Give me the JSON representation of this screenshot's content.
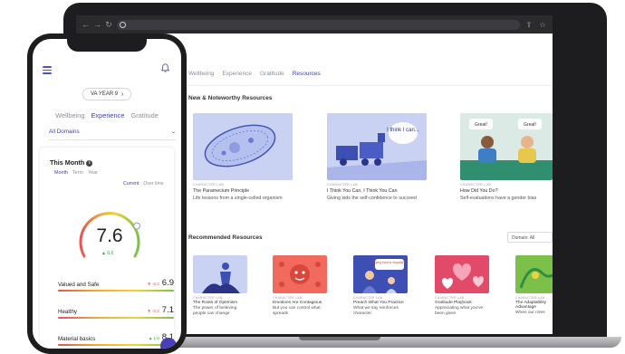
{
  "web": {
    "nav_tabs": [
      {
        "label": "Wellbeing",
        "active": false
      },
      {
        "label": "Experience",
        "active": false
      },
      {
        "label": "Gratitude",
        "active": false
      },
      {
        "label": "Resources",
        "active": true
      }
    ],
    "new_section_title": "New & Noteworthy Resources",
    "featured": [
      {
        "meta": "CHARACTER LAB",
        "title": "The Paramecium Principle",
        "desc": "Life lessons from a single-celled organism"
      },
      {
        "meta": "CHARACTER LAB",
        "title": "I Think You Can, I Think You Can",
        "desc": "Giving kids the self-confidence to succeed",
        "thumb_text": "I think I can..."
      },
      {
        "meta": "CHARACTER LAB",
        "title": "How Did You Do?",
        "desc": "Self-evaluations have a gender bias",
        "bubble_left": "Great!",
        "bubble_right": "Great!"
      }
    ],
    "recommended_title": "Recommended Resources",
    "domain_select": "Domain: All",
    "recommended": [
      {
        "meta": "CHARACTER LAB",
        "title": "The Roots of Optimism",
        "desc": "The power of believing people can change"
      },
      {
        "meta": "CHARACTER LAB",
        "title": "Emotions Are Contagious",
        "desc": "But you can control what spreads"
      },
      {
        "meta": "CHARACTER LAB",
        "title": "Preach What You Practice",
        "desc": "What we say reinforces character.",
        "thumb_text": "Trying hard is important!"
      },
      {
        "meta": "CHARACTER LAB",
        "title": "Gratitude Playbook",
        "desc": "Appreciating what you've been given"
      },
      {
        "meta": "CHARACTER LAB",
        "title": "The Adaptability Advantage",
        "desc": "When our roles"
      }
    ]
  },
  "phone": {
    "year_label": "VA YEAR 9",
    "tabs": [
      {
        "label": "Wellbeing",
        "active": false
      },
      {
        "label": "Experience",
        "active": true
      },
      {
        "label": "Gratitude",
        "active": false
      }
    ],
    "domains_label": "All Domains",
    "this_month": "This Month",
    "periods": [
      {
        "label": "Month",
        "active": true
      },
      {
        "label": "Term",
        "active": false
      },
      {
        "label": "Year",
        "active": false
      }
    ],
    "views": [
      {
        "label": "Current",
        "active": true
      },
      {
        "label": "Over time",
        "active": false
      }
    ],
    "gauge": {
      "value": "7.6",
      "delta": "▲ 0.6",
      "fraction": 0.76
    },
    "metrics": [
      {
        "label": "Valued and Safe",
        "delta": "▼ -0.2",
        "direction": "down",
        "value": "6.9"
      },
      {
        "label": "Healthy",
        "delta": "▼ -0.3",
        "direction": "down",
        "value": "7.1"
      },
      {
        "label": "Material basics",
        "delta": "▲ 1.6",
        "direction": "up",
        "value": "8.1"
      }
    ]
  },
  "colors": {
    "accent": "#3b3fb3",
    "positive": "#2f9e44",
    "negative": "#e55353"
  }
}
